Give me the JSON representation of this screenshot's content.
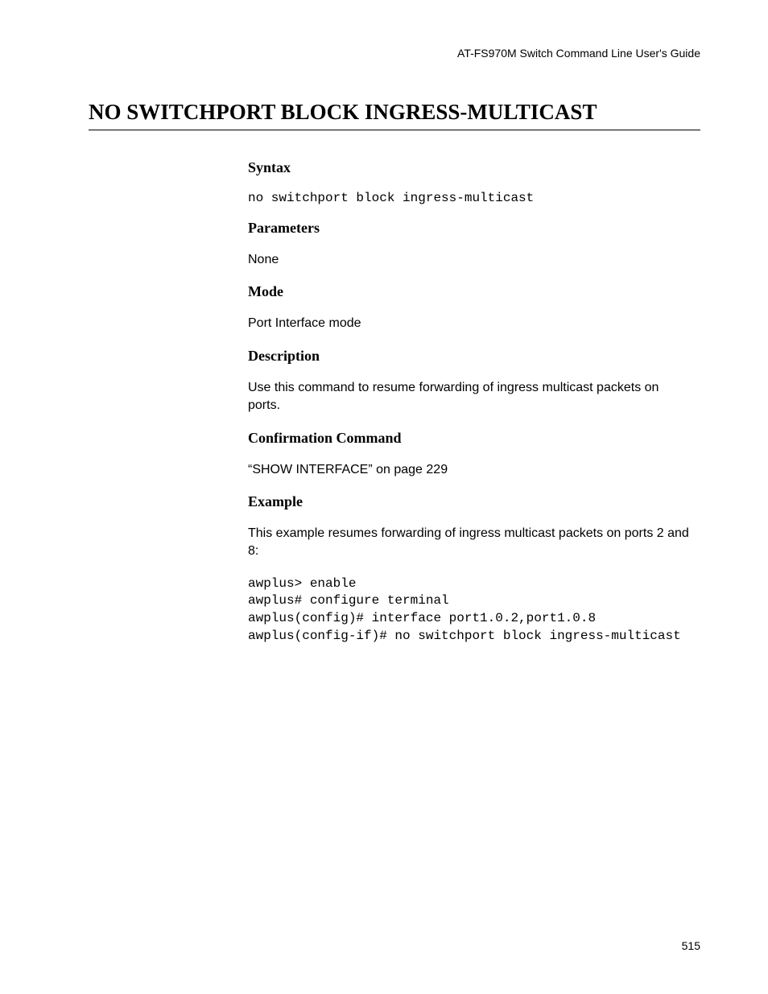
{
  "header": {
    "guide_title": "AT-FS970M Switch Command Line User's Guide"
  },
  "title": "NO SWITCHPORT BLOCK INGRESS-MULTICAST",
  "sections": {
    "syntax": {
      "heading": "Syntax",
      "command": "no switchport block ingress-multicast"
    },
    "parameters": {
      "heading": "Parameters",
      "text": "None"
    },
    "mode": {
      "heading": "Mode",
      "text": "Port Interface mode"
    },
    "description": {
      "heading": "Description",
      "text": "Use this command to resume forwarding of ingress multicast packets on ports."
    },
    "confirmation": {
      "heading": "Confirmation Command",
      "text": "“SHOW INTERFACE” on page 229"
    },
    "example": {
      "heading": "Example",
      "intro": "This example resumes forwarding of ingress multicast packets on ports 2 and 8:",
      "code": "awplus> enable\nawplus# configure terminal\nawplus(config)# interface port1.0.2,port1.0.8\nawplus(config-if)# no switchport block ingress-multicast"
    }
  },
  "page_number": "515"
}
